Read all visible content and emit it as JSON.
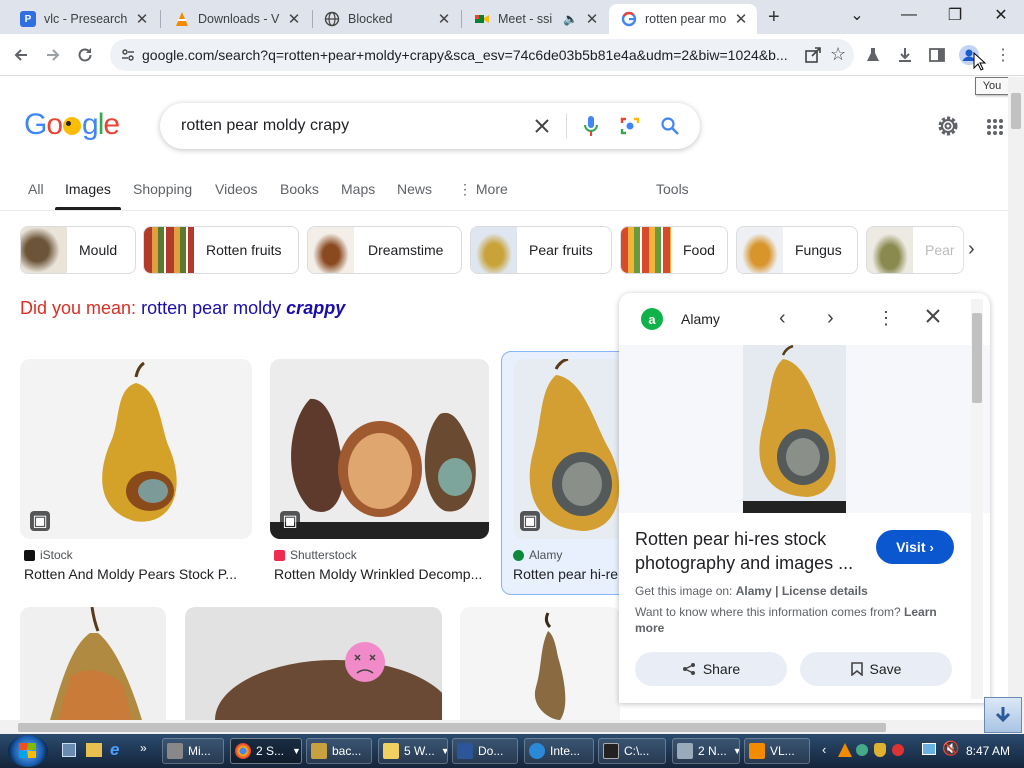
{
  "tabs": [
    {
      "title": "vlc - Presearch",
      "icon": "presearch-icon"
    },
    {
      "title": "Downloads - V",
      "icon": "vlc-icon"
    },
    {
      "title": "Blocked",
      "icon": "globe-icon"
    },
    {
      "title": "Meet - ssi",
      "icon": "meet-icon"
    },
    {
      "title": "rotten pear mo",
      "icon": "google-icon"
    }
  ],
  "address": {
    "url": "google.com/search?q=rotten+pear+moldy+crapy&sca_esv=74c6de03b5b81e4a&udm=2&biw=1024&b..."
  },
  "tooltip": "You",
  "search": {
    "query": "rotten pear moldy crapy"
  },
  "nav": {
    "items": [
      "All",
      "Images",
      "Shopping",
      "Videos",
      "Books",
      "Maps",
      "News"
    ],
    "more": "More",
    "tools": "Tools",
    "active": "Images"
  },
  "chips": [
    "Mould",
    "Rotten fruits",
    "Dreamstime",
    "Pear fruits",
    "Food",
    "Fungus",
    "Pear"
  ],
  "did_you_mean": {
    "prefix": "Did you mean:",
    "normal": "rotten pear moldy",
    "corrected": "crappy"
  },
  "results": [
    {
      "source": "iStock",
      "title": "Rotten And Moldy Pears Stock P..."
    },
    {
      "source": "Shutterstock",
      "title": "Rotten Moldy Wrinkled Decomp..."
    },
    {
      "source": "Alamy",
      "title": "Rotten pear hi-re"
    }
  ],
  "panel": {
    "source": "Alamy",
    "title_line1": "Rotten pear hi-res stock",
    "title_line2": "photography and images ...",
    "visit": "Visit",
    "get_prefix": "Get this image on:",
    "get_source": "Alamy",
    "license": "License details",
    "info_question": "Want to know where this information comes from?",
    "learn_more": "Learn more",
    "share": "Share",
    "save": "Save"
  },
  "taskbar": {
    "items": [
      "Mi...",
      "2 S...",
      "bac...",
      "5 W...",
      "Do...",
      "Inte...",
      "C:\\...",
      "2 N...",
      "VL..."
    ],
    "clock": "8:47 AM"
  },
  "colors": {
    "accent": "#0b57d0",
    "tab_strip": "#dfe3eb",
    "did_you_mean": "#d93025",
    "link": "#1a0dab"
  }
}
